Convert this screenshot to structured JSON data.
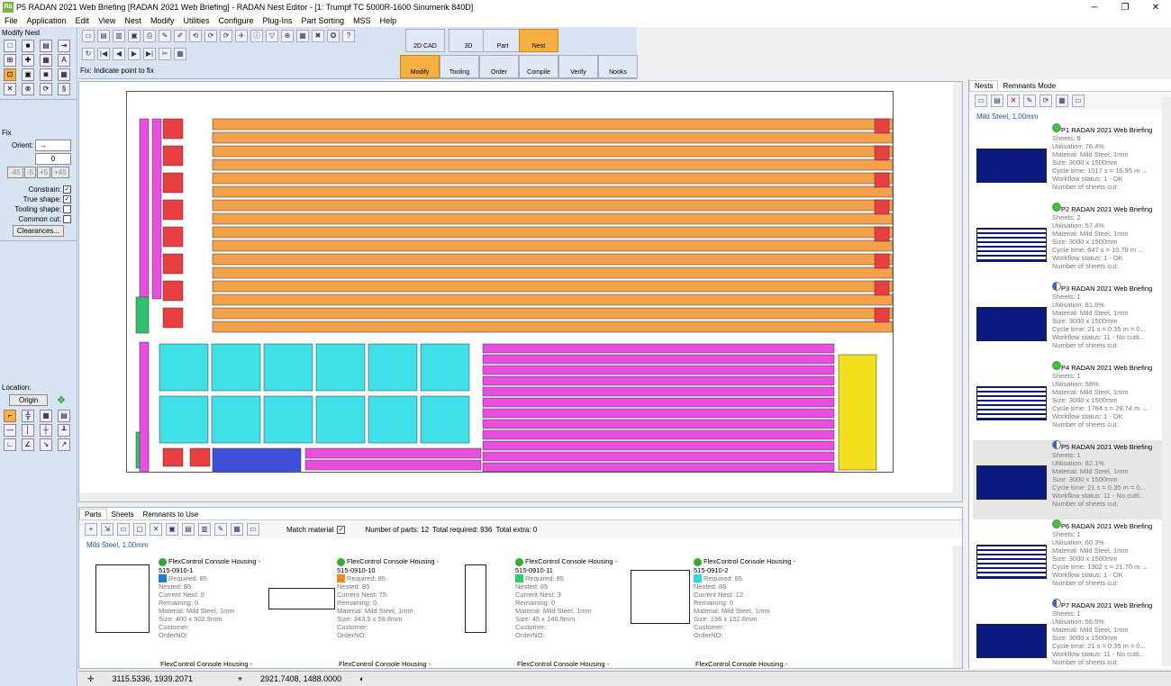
{
  "window": {
    "title": "P5 RADAN 2021 Web Briefing [RADAN 2021 Web Briefing] - RADAN Nest Editor - [1: Trumpf TC 5000R-1600 Sinumerik 840D]",
    "app_badge": "Ra"
  },
  "menu": [
    "File",
    "Application",
    "Edit",
    "View",
    "Nest",
    "Modify",
    "Utilities",
    "Configure",
    "Plug-Ins",
    "Part Sorting",
    "MSS",
    "Help"
  ],
  "left": {
    "modify_nest": "Modify Nest",
    "fix": "Fix",
    "orient_label": "Orient:",
    "orient_value": "→",
    "value_field": "0",
    "steps": [
      "-45",
      "-5",
      "+5",
      "+45"
    ],
    "constrain": "Constrain:",
    "true_shape": "True shape:",
    "tooling_shape": "Tooling shape:",
    "common_cut": "Common cut:",
    "clearances": "Clearances...",
    "location": "Location:",
    "origin": "Origin"
  },
  "toolbar": {
    "prompt": "Fix: Indicate point to fix"
  },
  "modes": [
    {
      "label": "2D CAD",
      "sel": false
    },
    {
      "label": "3D",
      "sel": false
    },
    {
      "label": "Part",
      "sel": false
    },
    {
      "label": "Nest",
      "sel": true
    },
    {
      "label": "Modify",
      "sel": true
    },
    {
      "label": "Tooling",
      "sel": false
    },
    {
      "label": "Order",
      "sel": false
    },
    {
      "label": "Compile",
      "sel": false
    },
    {
      "label": "Verify",
      "sel": false
    },
    {
      "label": "Nooks",
      "sel": false
    }
  ],
  "bottom": {
    "tabs": [
      "Parts",
      "Sheets",
      "Remnants to Use"
    ],
    "match_material": "Match material",
    "num_parts": "Number of parts: 12",
    "total_required": "Total required: 936",
    "total_extra": "Total extra: 0",
    "material_header": "Mild Steel, 1.00mm",
    "parts": [
      {
        "title": "FlexControl Console Housing -",
        "code": "515-0910-1",
        "color": "#1e7fd8",
        "required": "Required: 85",
        "nested": "Nested: 85",
        "current": "Current Nest: 0",
        "remaining": "Remaining: 0",
        "material": "Material: Mild Steel, 1mm",
        "size": "Size: 400 x 502.9mm",
        "customer": "Customer:",
        "order": "OrderNO:"
      },
      {
        "title": "FlexControl Console Housing -",
        "code": "515-0910-10",
        "color": "#f08a1c",
        "required": "Required: 85",
        "nested": "Nested: 85",
        "current": "Current Nest: 75",
        "remaining": "Remaining: 0",
        "material": "Material: Mild Steel, 1mm",
        "size": "Size: 343.5 x 59.8mm",
        "customer": "Customer:",
        "order": "OrderNO:"
      },
      {
        "title": "FlexControl Console Housing -",
        "code": "515-0910-11",
        "color": "#2fcf6a",
        "required": "Required: 85",
        "nested": "Nested: 85",
        "current": "Current Nest: 3",
        "remaining": "Remaining: 0",
        "material": "Material: Mild Steel, 1mm",
        "size": "Size: 45 x 146.9mm",
        "customer": "Customer:",
        "order": "OrderNO:"
      },
      {
        "title": "FlexControl Console Housing -",
        "code": "515-0910-2",
        "color": "#30d8e0",
        "required": "Required: 85",
        "nested": "Nested: 85",
        "current": "Current Nest: 12",
        "remaining": "Remaining: 0",
        "material": "Material: Mild Steel, 1mm",
        "size": "Size: 196 x 152.6mm",
        "customer": "Customer:",
        "order": "OrderNO:"
      }
    ],
    "more_row": [
      "FlexControl Console Housing -",
      "FlexControl Console Housing -",
      "FlexControl Console Housing -",
      "FlexControl Console Housing -"
    ]
  },
  "right": {
    "tabs": [
      "Nests",
      "Remnants Mode"
    ],
    "material_header": "Mild Steel, 1.00mm",
    "nests": [
      {
        "name": "P1 RADAN 2021 Web Briefing",
        "sheets": "Sheets: 9",
        "util": "Utilisation: 76.4%",
        "material": "Material: Mild Steel, 1mm",
        "size": "Size: 3000 x 1500mm",
        "cycle": "Cycle time: 1017 s = 16.95 m ...",
        "workflow": "Workflow status: 1 - OK",
        "cut": "Number of sheets cut:",
        "status": "ok",
        "sel": false
      },
      {
        "name": "P2 RADAN 2021 Web Briefing",
        "sheets": "Sheets: 2",
        "util": "Utilisation: 57.4%",
        "material": "Material: Mild Steel, 1mm",
        "size": "Size: 3000 x 1500mm",
        "cycle": "Cycle time: 647 s = 10.79 m ...",
        "workflow": "Workflow status: 1 - OK",
        "cut": "Number of sheets cut:",
        "status": "ok",
        "sel": false
      },
      {
        "name": "P3 RADAN 2021 Web Briefing",
        "sheets": "Sheets: 1",
        "util": "Utilisation: 81.6%",
        "material": "Material: Mild Steel, 1mm",
        "size": "Size: 3000 x 1500mm",
        "cycle": "Cycle time: 21 s = 0.35 m = 0...",
        "workflow": "Workflow status: 11 - No cutti...",
        "cut": "Number of sheets cut:",
        "status": "half",
        "sel": false
      },
      {
        "name": "P4 RADAN 2021 Web Briefing",
        "sheets": "Sheets: 1",
        "util": "Utilisation: 58%",
        "material": "Material: Mild Steel, 1mm",
        "size": "Size: 3000 x 1500mm",
        "cycle": "Cycle time: 1784 s = 29.74 m ...",
        "workflow": "Workflow status: 1 - OK",
        "cut": "Number of sheets cut:",
        "status": "ok",
        "sel": false
      },
      {
        "name": "P5 RADAN 2021 Web Briefing",
        "sheets": "Sheets: 1",
        "util": "Utilisation: 82.1%",
        "material": "Material: Mild Steel, 1mm",
        "size": "Size: 3000 x 1500mm",
        "cycle": "Cycle time: 21 s = 0.35 m = 0...",
        "workflow": "Workflow status: 11 - No cutti...",
        "cut": "Number of sheets cut:",
        "status": "half",
        "sel": true
      },
      {
        "name": "P6 RADAN 2021 Web Briefing",
        "sheets": "Sheets: 1",
        "util": "Utilisation: 60.3%",
        "material": "Material: Mild Steel, 1mm",
        "size": "Size: 3000 x 1500mm",
        "cycle": "Cycle time: 1302 s = 21.70 m ...",
        "workflow": "Workflow status: 1 - OK",
        "cut": "Number of sheets cut:",
        "status": "ok",
        "sel": false
      },
      {
        "name": "P7 RADAN 2021 Web Briefing",
        "sheets": "Sheets: 1",
        "util": "Utilisation: 56.5%",
        "material": "Material: Mild Steel, 1mm",
        "size": "Size: 3000 x 1500mm",
        "cycle": "Cycle time: 21 s = 0.35 m = 0...",
        "workflow": "Workflow status: 11 - No cutti...",
        "cut": "Number of sheets cut:",
        "status": "half",
        "sel": false
      }
    ]
  },
  "status": {
    "coords1": "3115.5336, 1939.2071",
    "coords2": "2921.7408, 1488.0000"
  },
  "colors": {
    "orange": "#f5a04a",
    "magenta": "#e84fe0",
    "cyan": "#3fe0e8",
    "yellow": "#f0e020",
    "green": "#30c070",
    "blue": "#4050d8",
    "accent": "#f5b041"
  }
}
